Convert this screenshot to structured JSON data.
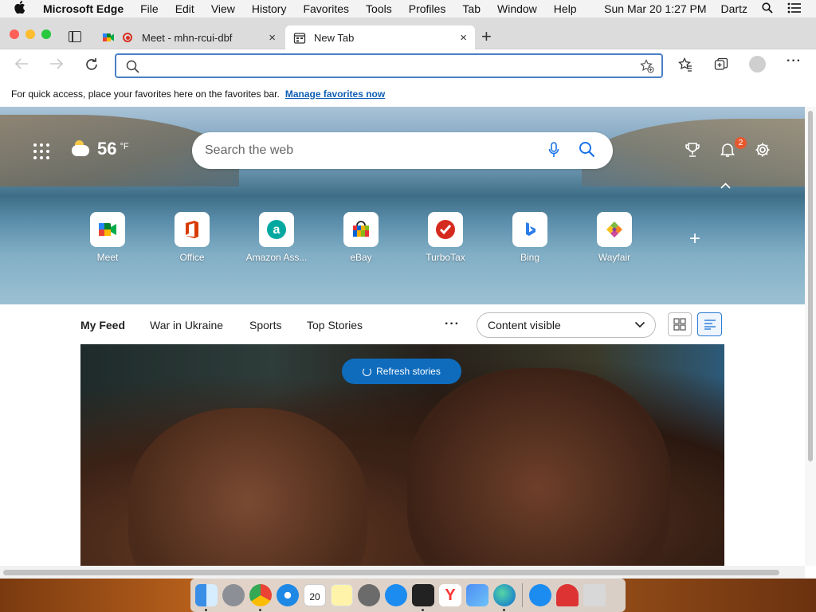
{
  "menubar": {
    "apple": "",
    "app_name": "Microsoft Edge",
    "items": [
      "File",
      "Edit",
      "View",
      "History",
      "Favorites",
      "Tools",
      "Profiles",
      "Tab",
      "Window",
      "Help"
    ],
    "datetime": "Sun Mar 20  1:27 PM",
    "user": "Dartz"
  },
  "tabs": [
    {
      "title": "Meet - mhn-rcui-dbf",
      "close": "×"
    },
    {
      "title": "New Tab",
      "close": "×"
    }
  ],
  "toolbar": {
    "new_tab": "+",
    "address_value": "",
    "more": "···"
  },
  "favorites_bar": {
    "message": "For quick access, place your favorites here on the favorites bar.",
    "link": "Manage favorites now"
  },
  "weather": {
    "temperature": "56",
    "unit": "°F"
  },
  "search": {
    "placeholder": "Search the web"
  },
  "notifications": {
    "count": "2"
  },
  "quick_links": [
    {
      "label": "Meet"
    },
    {
      "label": "Office"
    },
    {
      "label": "Amazon Ass..."
    },
    {
      "label": "eBay"
    },
    {
      "label": "TurboTax"
    },
    {
      "label": "Bing"
    },
    {
      "label": "Wayfair"
    }
  ],
  "add_site": "+",
  "feed": {
    "tabs": [
      "My Feed",
      "War in Ukraine",
      "Sports",
      "Top Stories"
    ],
    "more": "···",
    "content_dropdown": "Content visible",
    "refresh_label": "Refresh stories"
  },
  "dock": {
    "calendar_day": "20"
  }
}
